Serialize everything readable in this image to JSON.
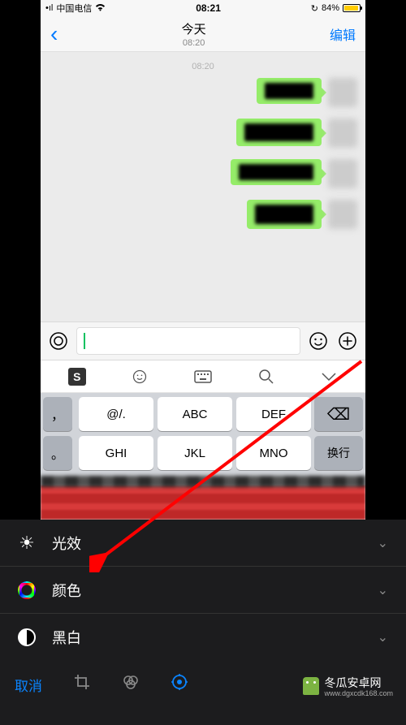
{
  "statusbar": {
    "carrier": "中国电信",
    "time": "08:21",
    "battery_percent": "84%"
  },
  "nav": {
    "title": "今天",
    "subtitle": "08:20",
    "edit": "编辑"
  },
  "chat": {
    "timestamp": "08:20"
  },
  "keyboard": {
    "row1": {
      "k1": "@/.",
      "k2": "ABC",
      "k3": "DEF"
    },
    "row2": {
      "k1": "GHI",
      "k2": "JKL",
      "k3": "MNO"
    },
    "side": {
      "comma": "，",
      "period": "。"
    },
    "right": {
      "backspace": "⌫",
      "enter": "换行"
    }
  },
  "edit": {
    "light": "光效",
    "color": "颜色",
    "bw": "黑白"
  },
  "toolbar": {
    "cancel": "取消"
  },
  "watermark": {
    "text": "冬瓜安卓网",
    "url": "www.dgxcdk168.com"
  }
}
